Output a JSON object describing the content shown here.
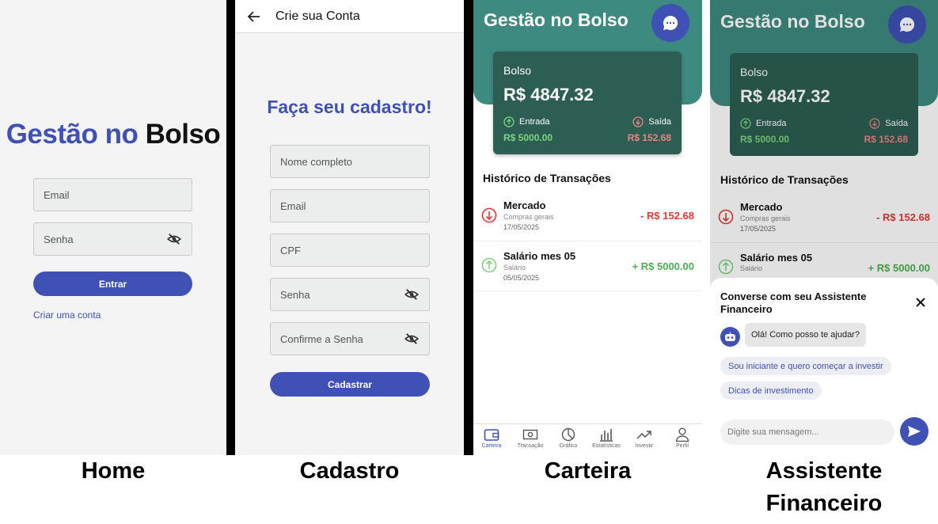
{
  "home": {
    "title_part1": "Gestão no",
    "title_part2": "Bolso",
    "email_placeholder": "Email",
    "password_placeholder": "Senha",
    "login_button": "Entrar",
    "create_account_link": "Criar uma conta",
    "caption": "Home"
  },
  "cadastro": {
    "header_title": "Crie sua Conta",
    "heading": "Faça seu cadastro!",
    "fields": [
      "Nome completo",
      "Email",
      "CPF",
      "Senha",
      "Confirme a Senha"
    ],
    "submit_button": "Cadastrar",
    "caption": "Cadastro"
  },
  "carteira": {
    "app_title": "Gestão no Bolso",
    "balance_label": "Bolso",
    "balance_value": "R$ 4847.32",
    "income_label": "Entrada",
    "income_value": "R$ 5000.00",
    "expense_label": "Saída",
    "expense_value": "R$ 152.68",
    "history_title": "Histórico de Transações",
    "transactions": [
      {
        "name": "Mercado",
        "category": "Compras gerais",
        "date": "17/05/2025",
        "amount": "- R$ 152.68",
        "type": "expense"
      },
      {
        "name": "Salário mes 05",
        "category": "Salário",
        "date": "05/05/2025",
        "amount": "+ R$ 5000.00",
        "type": "income"
      }
    ],
    "nav": [
      "Carteira",
      "Transação",
      "Gráfico",
      "Estatísticas",
      "Investir",
      "Perfil"
    ],
    "caption": "Carteira"
  },
  "assistente": {
    "app_title": "Gestão no Bolso",
    "balance_label": "Bolso",
    "balance_value": "R$ 4847.32",
    "income_label": "Entrada",
    "income_value": "R$ 5000.00",
    "expense_label": "Saída",
    "expense_value": "R$ 152.68",
    "history_title": "Histórico de Transações",
    "tx1_name": "Mercado",
    "tx1_category": "Compras gerais",
    "tx1_date": "17/05/2025",
    "tx1_amount": "- R$ 152.68",
    "tx2_name": "Salário mes 05",
    "tx2_category": "Salário",
    "tx2_amount": "+ R$ 5000.00",
    "chat_title_line1": "Converse com seu Assistente",
    "chat_title_line2": "Financeiro",
    "bot_message": "Olá! Como posso te ajudar?",
    "suggestions": [
      "Sou iniciante e quero começar a investir",
      "Dicas de investimento"
    ],
    "input_placeholder": "Digite sua mensagem...",
    "caption_line1": "Assistente",
    "caption_line2": "Financeiro"
  },
  "colors": {
    "primary": "#3f51b5",
    "teal": "#3d8a80",
    "card": "#2c5e53",
    "income": "#4caf50",
    "expense": "#e53935"
  }
}
